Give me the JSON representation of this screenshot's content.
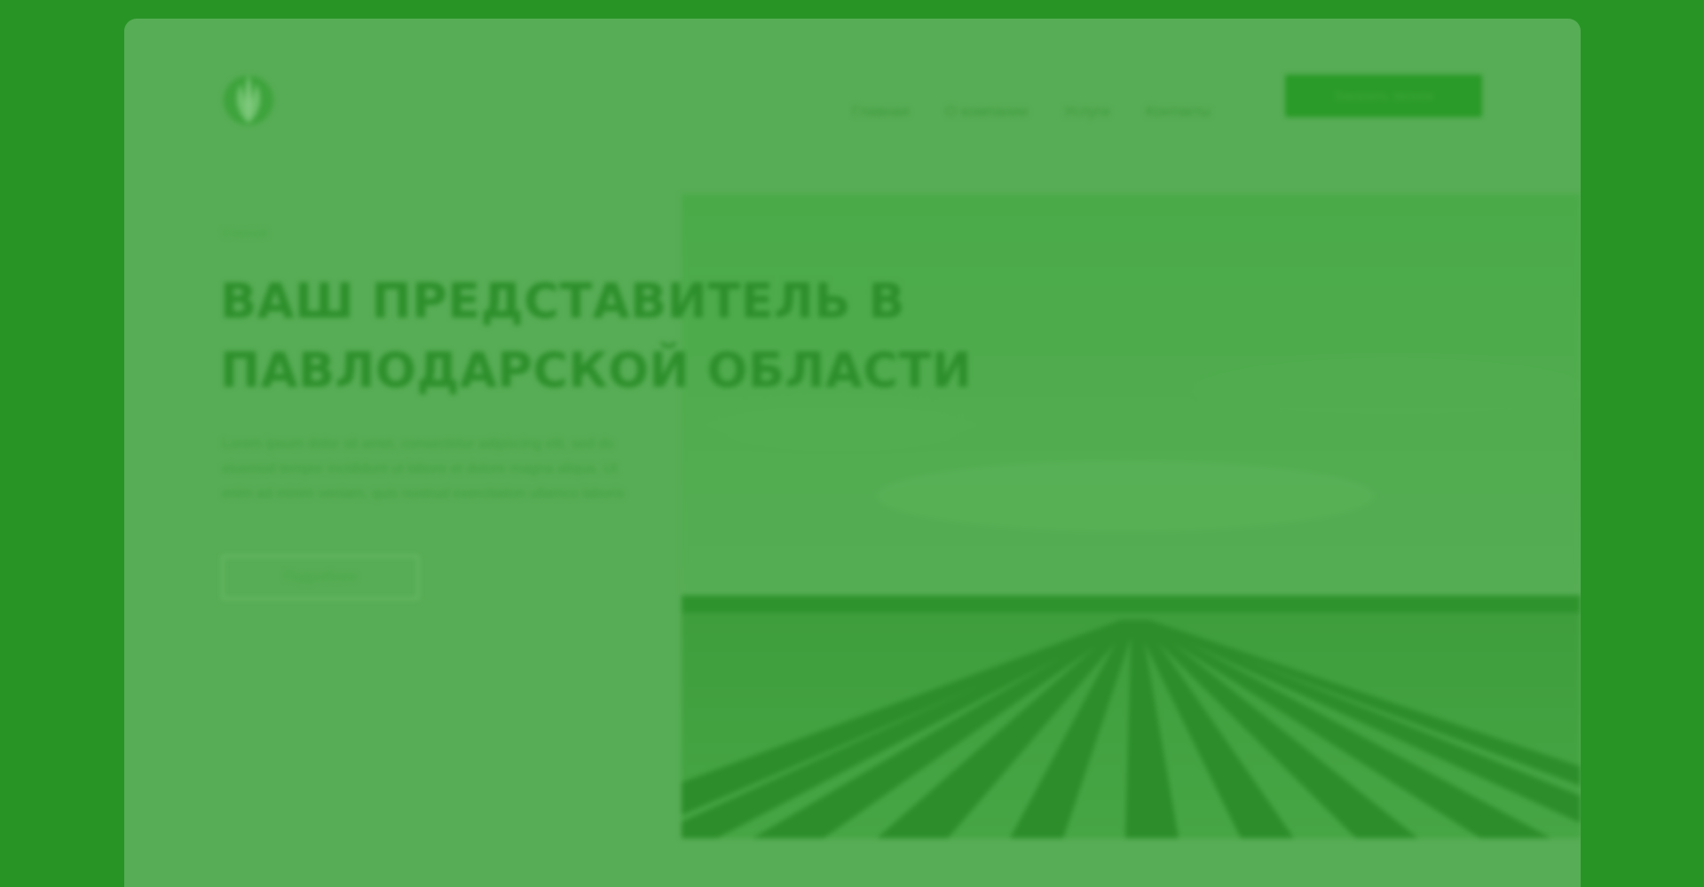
{
  "header": {
    "logo_icon": "wheat-sprout-icon",
    "nav": [
      "Главная",
      "О компании",
      "Услуги",
      "Контакты"
    ],
    "cta_label": "Заказать звонок"
  },
  "hero": {
    "eyebrow": "Степной",
    "title": "ВАШ ПРЕДСТАВИТЕЛЬ В ПАВЛОДАРСКОЙ ОБЛАСТИ",
    "description": "Lorem ipsum dolor sit amet, consectetur adipiscing elit, sed do eiusmod tempor incididunt ut labore et dolore magna aliqua. Ut enim ad minim veniam, quis nostrud exercitation ullamco laboris",
    "button_label": "Подробнее",
    "image_subject": "vineyard-field-photo"
  },
  "colors": {
    "background": "#289426",
    "overlay": "#57ad55",
    "accent": "#2a9a28"
  }
}
